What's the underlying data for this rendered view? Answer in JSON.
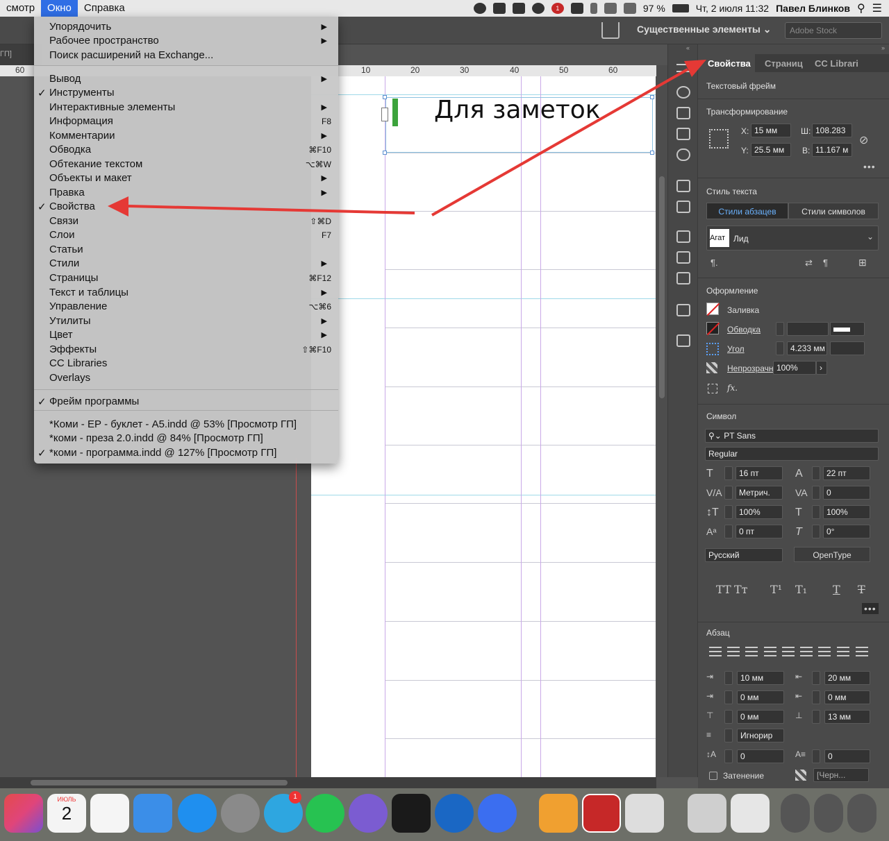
{
  "menubar": {
    "items": [
      "смотр",
      "Окно",
      "Справка"
    ],
    "active": "Окно",
    "right": {
      "battery": "97 %",
      "datetime": "Чт, 2 июля  11:32",
      "user": "Павел Блинков"
    }
  },
  "toolbar": {
    "workspace": "Существенные элементы",
    "stock_placeholder": "Adobe Stock"
  },
  "document": {
    "tab_label": "ГП]",
    "ruler_ticks": [
      "60",
      "10",
      "20",
      "30",
      "40",
      "50",
      "60"
    ],
    "note_text": "Для заметок"
  },
  "menu": {
    "items": [
      {
        "label": "Упорядочить",
        "arrow": "▶",
        "shortcut": "",
        "checked": ""
      },
      {
        "label": "Рабочее пространство",
        "arrow": "▶",
        "shortcut": "",
        "checked": ""
      },
      {
        "label": "Поиск расширений на Exchange...",
        "arrow": "",
        "shortcut": "",
        "checked": ""
      },
      {
        "label": "Вывод",
        "arrow": "▶",
        "shortcut": "",
        "checked": ""
      },
      {
        "label": "Инструменты",
        "arrow": "",
        "shortcut": "",
        "checked": "✓"
      },
      {
        "label": "Интерактивные элементы",
        "arrow": "▶",
        "shortcut": "",
        "checked": ""
      },
      {
        "label": "Информация",
        "arrow": "",
        "shortcut": "F8",
        "checked": ""
      },
      {
        "label": "Комментарии",
        "arrow": "▶",
        "shortcut": "",
        "checked": ""
      },
      {
        "label": "Обводка",
        "arrow": "",
        "shortcut": "⌘F10",
        "checked": ""
      },
      {
        "label": "Обтекание текстом",
        "arrow": "",
        "shortcut": "⌥⌘W",
        "checked": ""
      },
      {
        "label": "Объекты и макет",
        "arrow": "▶",
        "shortcut": "",
        "checked": ""
      },
      {
        "label": "Правка",
        "arrow": "▶",
        "shortcut": "",
        "checked": ""
      },
      {
        "label": "Свойства",
        "arrow": "",
        "shortcut": "",
        "checked": "✓"
      },
      {
        "label": "Связи",
        "arrow": "",
        "shortcut": "⇧⌘D",
        "checked": ""
      },
      {
        "label": "Слои",
        "arrow": "",
        "shortcut": "F7",
        "checked": ""
      },
      {
        "label": "Статьи",
        "arrow": "",
        "shortcut": "",
        "checked": ""
      },
      {
        "label": "Стили",
        "arrow": "▶",
        "shortcut": "",
        "checked": ""
      },
      {
        "label": "Страницы",
        "arrow": "",
        "shortcut": "⌘F12",
        "checked": ""
      },
      {
        "label": "Текст и таблицы",
        "arrow": "▶",
        "shortcut": "",
        "checked": ""
      },
      {
        "label": "Управление",
        "arrow": "",
        "shortcut": "⌥⌘6",
        "checked": ""
      },
      {
        "label": "Утилиты",
        "arrow": "▶",
        "shortcut": "",
        "checked": ""
      },
      {
        "label": "Цвет",
        "arrow": "▶",
        "shortcut": "",
        "checked": ""
      },
      {
        "label": "Эффекты",
        "arrow": "",
        "shortcut": "⇧⌘F10",
        "checked": ""
      },
      {
        "label": "CC Libraries",
        "arrow": "",
        "shortcut": "",
        "checked": ""
      },
      {
        "label": "Overlays",
        "arrow": "",
        "shortcut": "",
        "checked": ""
      },
      {
        "label": "Фрейм программы",
        "arrow": "",
        "shortcut": "",
        "checked": "✓"
      },
      {
        "label": "*Коми - ЕР - буклет - А5.indd @ 53% [Просмотр ГП]",
        "arrow": "",
        "shortcut": "",
        "checked": ""
      },
      {
        "label": "*коми - преза 2.0.indd @ 84% [Просмотр ГП]",
        "arrow": "",
        "shortcut": "",
        "checked": ""
      },
      {
        "label": "*коми - программа.indd @ 127% [Просмотр ГП]",
        "arrow": "",
        "shortcut": "",
        "checked": "✓"
      }
    ]
  },
  "panel": {
    "tabs": [
      "Свойства",
      "Страниц",
      "CC Librari"
    ],
    "frame_type": "Текстовый фрейм",
    "transform": {
      "title": "Трансформирование",
      "x_label": "X:",
      "x": "15 мм",
      "y_label": "Y:",
      "y": "25.5 мм",
      "w_label": "Ш:",
      "w": "108.283",
      "h_label": "В:",
      "h": "11.167 м"
    },
    "text_style": {
      "title": "Стиль текста",
      "tab_paragraph": "Стили абзацев",
      "tab_character": "Стили символов",
      "preview": "Агат",
      "style_name": "Лид"
    },
    "appearance": {
      "title": "Оформление",
      "fill": "Заливка",
      "stroke": "Обводка",
      "corner": "Угол",
      "corner_value": "4.233 мм",
      "opacity": "Непрозрачн",
      "opacity_value": "100%",
      "fx": "fx."
    },
    "character": {
      "title": "Символ",
      "font": "PT Sans",
      "weight": "Regular",
      "size": "16 пт",
      "leading": "22 пт",
      "kerning": "Метрич.",
      "tracking": "0",
      "vscale": "100%",
      "hscale": "100%",
      "baseline": "0 пт",
      "skew": "0°",
      "language": "Русский",
      "opentype": "OpenType"
    },
    "paragraph": {
      "title": "Абзац",
      "left_indent": "10 мм",
      "right_indent": "20 мм",
      "first_indent": "0 мм",
      "last_indent": "0 мм",
      "space_before": "0 мм",
      "space_after": "13 мм",
      "grid_align": "Игнорир",
      "dropcap_lines": "0",
      "dropcap_chars": "0",
      "shading": "Затенение",
      "shading_color": "[Черн..."
    }
  },
  "dock": {
    "calendar_month": "ИЮЛЬ",
    "calendar_day": "2",
    "telegram_badge": "1",
    "menubar_badge": "1"
  }
}
